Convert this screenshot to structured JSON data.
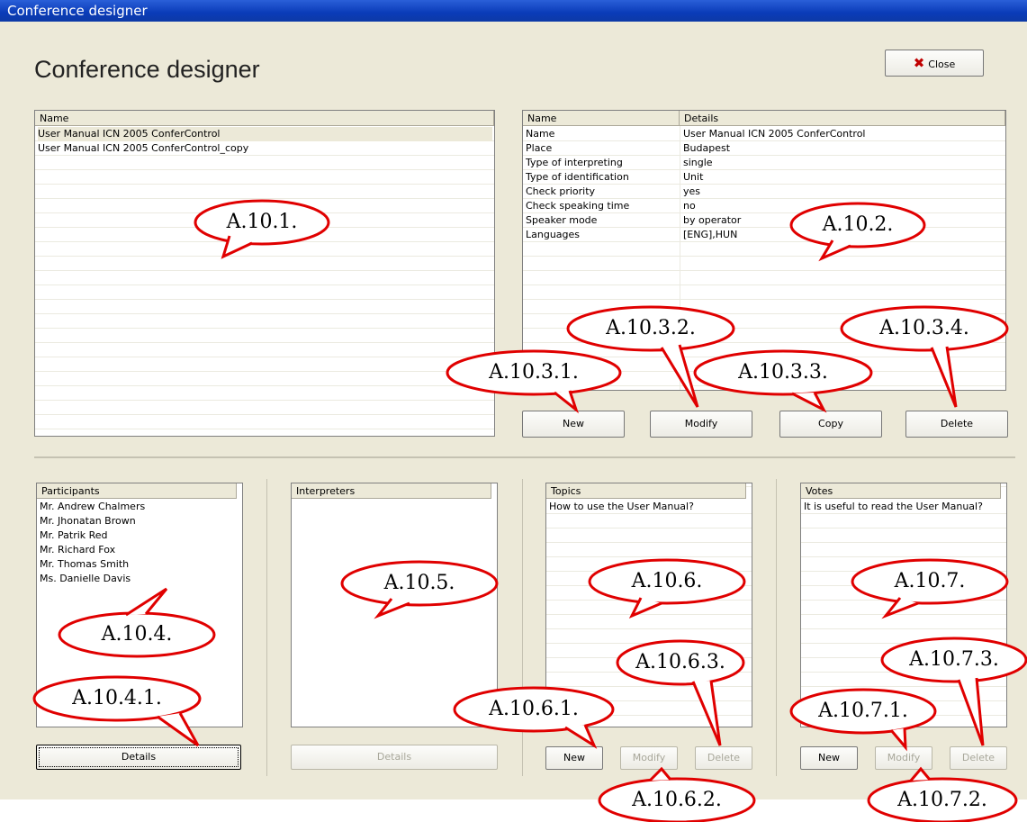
{
  "window": {
    "title": "Conference designer"
  },
  "header": {
    "title": "Conference designer",
    "close_label": "Close",
    "close_icon": "red-x-icon"
  },
  "conferences": {
    "column": "Name",
    "items": [
      "User Manual ICN 2005 ConferControl",
      "User Manual ICN 2005 ConferControl_copy"
    ]
  },
  "details": {
    "columns": [
      "Name",
      "Details"
    ],
    "rows": [
      [
        "Name",
        "User Manual ICN 2005 ConferControl"
      ],
      [
        "Place",
        "Budapest"
      ],
      [
        "Type of interpreting",
        "single"
      ],
      [
        "Type of identification",
        "Unit"
      ],
      [
        "Check priority",
        "yes"
      ],
      [
        "Check speaking time",
        "no"
      ],
      [
        "Speaker mode",
        "by operator"
      ],
      [
        "Languages",
        "[ENG],HUN"
      ]
    ]
  },
  "conference_buttons": {
    "new": "New",
    "modify": "Modify",
    "copy": "Copy",
    "delete": "Delete"
  },
  "participants": {
    "column": "Participants",
    "items": [
      "Mr. Andrew Chalmers",
      "Mr. Jhonatan Brown",
      "Mr. Patrik Red",
      "Mr. Richard Fox",
      "Mr. Thomas Smith",
      "Ms. Danielle Davis"
    ],
    "details_label": "Details"
  },
  "interpreters": {
    "column": "Interpreters",
    "items": [],
    "details_label": "Details"
  },
  "topics": {
    "column": "Topics",
    "items": [
      "How to use the User Manual?"
    ],
    "new": "New",
    "modify": "Modify",
    "delete": "Delete"
  },
  "votes": {
    "column": "Votes",
    "items": [
      "It is useful to read the User Manual?"
    ],
    "new": "New",
    "modify": "Modify",
    "delete": "Delete"
  },
  "callouts": {
    "c1": "A.10.1.",
    "c2": "A.10.2.",
    "c31": "A.10.3.1.",
    "c32": "A.10.3.2.",
    "c33": "A.10.3.3.",
    "c34": "A.10.3.4.",
    "c4": "A.10.4.",
    "c41": "A.10.4.1.",
    "c5": "A.10.5.",
    "c6": "A.10.6.",
    "c61": "A.10.6.1.",
    "c62": "A.10.6.2.",
    "c63": "A.10.6.3.",
    "c7": "A.10.7.",
    "c71": "A.10.7.1.",
    "c72": "A.10.7.2.",
    "c73": "A.10.7.3."
  },
  "colors": {
    "titlebar": "#0a3bb8",
    "window_bg": "#ECE9D8",
    "callout_stroke": "#e00000"
  }
}
